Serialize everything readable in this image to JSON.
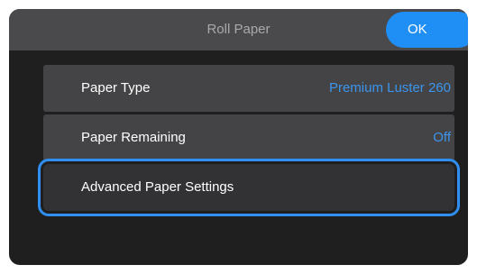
{
  "header": {
    "title": "Roll Paper",
    "ok_label": "OK"
  },
  "menu": {
    "items": [
      {
        "label": "Paper Type",
        "value": "Premium Luster 260"
      },
      {
        "label": "Paper Remaining",
        "value": "Off"
      },
      {
        "label": "Advanced Paper Settings"
      }
    ],
    "selected_item": "Advanced Paper Settings"
  },
  "colors": {
    "accent": "#1f8ff5",
    "value_text": "#3b95ee",
    "selection_ring": "#2f8ff2",
    "background": "#1f1f20",
    "header_bg": "#4a4a4c",
    "item_bg": "#444446"
  }
}
